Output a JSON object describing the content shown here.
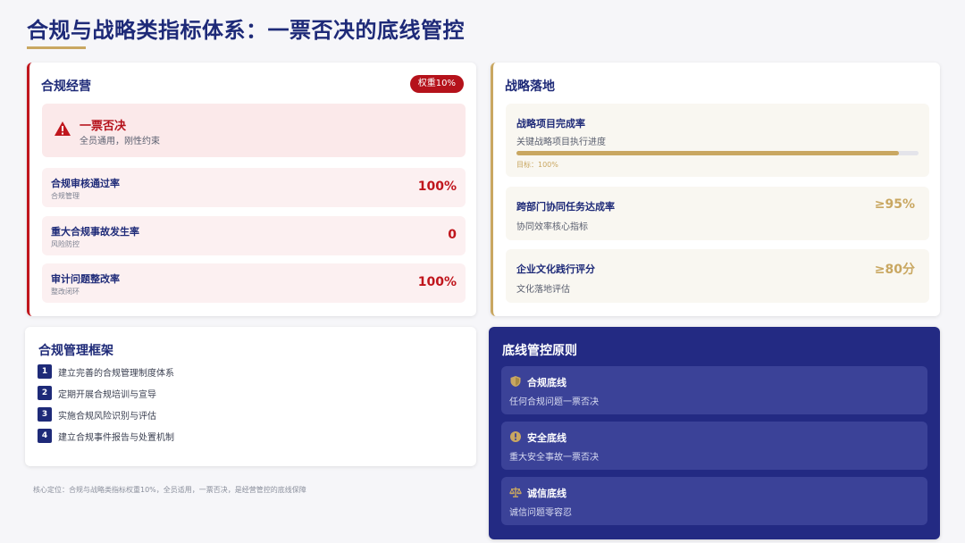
{
  "page": {
    "title": "合规与战略类指标体系：一票否决的底线管控",
    "footnote": "核心定位：合规与战略类指标权重10%，全员适用，一票否决，是经营管控的底线保障"
  },
  "compliance": {
    "title": "合规经营",
    "weight_badge": "权重10%",
    "veto": {
      "icon": "warning-icon",
      "title": "一票否决",
      "subtitle": "全员通用，刚性约束"
    },
    "metrics": [
      {
        "name": "合规审核通过率",
        "sub": "合规管理",
        "value": "100%"
      },
      {
        "name": "重大合规事故发生率",
        "sub": "风险防控",
        "value": "0"
      },
      {
        "name": "审计问题整改率",
        "sub": "整改闭环",
        "value": "100%"
      }
    ]
  },
  "strategy": {
    "title": "战略落地",
    "items": [
      {
        "name": "战略项目完成率",
        "sub": "关键战略项目执行进度",
        "progress": 0.95,
        "target": "目标：100%"
      },
      {
        "name": "跨部门协同任务达成率",
        "sub": "协同效率核心指标",
        "value": "≥95%"
      },
      {
        "name": "企业文化践行评分",
        "sub": "文化落地评估",
        "value": "≥80分"
      }
    ]
  },
  "framework": {
    "title": "合规管理框架",
    "steps": [
      {
        "num": "1",
        "text": "建立完善的合规管理制度体系"
      },
      {
        "num": "2",
        "text": "定期开展合规培训与宣导"
      },
      {
        "num": "3",
        "text": "实施合规风险识别与评估"
      },
      {
        "num": "4",
        "text": "建立合规事件报告与处置机制"
      }
    ]
  },
  "principles": {
    "title": "底线管控原则",
    "items": [
      {
        "icon": "shield-icon",
        "title": "合规底线",
        "sub": "任何合规问题一票否决"
      },
      {
        "icon": "alert-circle-icon",
        "title": "安全底线",
        "sub": "重大安全事故一票否决"
      },
      {
        "icon": "scales-icon",
        "title": "诚信底线",
        "sub": "诚信问题零容忍"
      }
    ]
  },
  "colors": {
    "navy": "#1e2a78",
    "red": "#c0161d",
    "gold": "#c9a761",
    "principles_bg": "#232a83"
  }
}
